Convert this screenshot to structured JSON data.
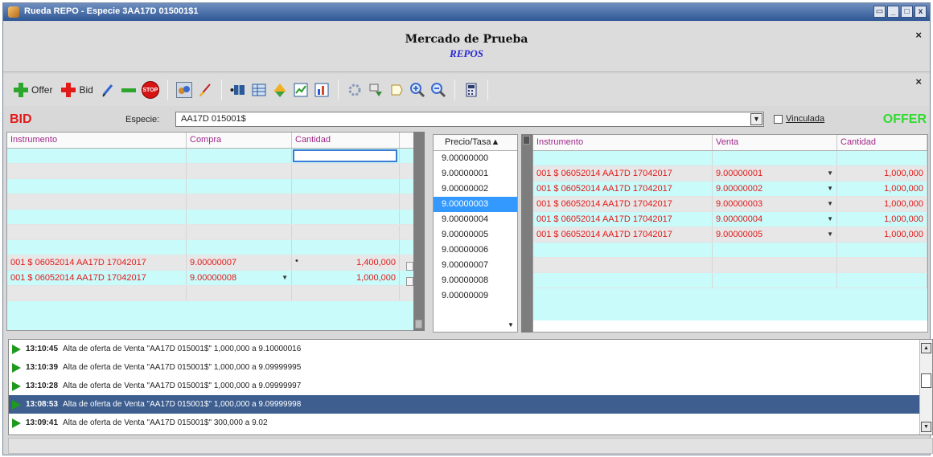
{
  "window": {
    "title": "Rueda REPO - Especie 3AA17D 015001$1"
  },
  "header": {
    "market": "Mercado de Prueba",
    "subtitle": "REPOS"
  },
  "toolbar": {
    "offer_label": "Offer",
    "bid_label": "Bid"
  },
  "bid_label": "BID",
  "offer_label": "OFFER",
  "especie": {
    "label": "Especie:",
    "value": "AA17D 015001$"
  },
  "vinculada_label": "Vinculada",
  "bid_table": {
    "headers": [
      "Instrumento",
      "Compra",
      "Cantidad"
    ],
    "rows": [
      {
        "instrumento": "001 $ 06052014 AA17D 17042017",
        "compra": "9.00000007",
        "cantidad": "1,400,000"
      },
      {
        "instrumento": "001 $ 06052014 AA17D 17042017",
        "compra": "9.00000008",
        "cantidad": "1,000,000"
      }
    ]
  },
  "prices": {
    "header": "Precio/Tasa",
    "values": [
      "9.00000000",
      "9.00000001",
      "9.00000002",
      "9.00000003",
      "9.00000004",
      "9.00000005",
      "9.00000006",
      "9.00000007",
      "9.00000008",
      "9.00000009"
    ]
  },
  "offer_table": {
    "headers": [
      "Instrumento",
      "Venta",
      "Cantidad"
    ],
    "rows": [
      {
        "instrumento": "001 $ 06052014 AA17D 17042017",
        "venta": "9.00000001",
        "cantidad": "1,000,000"
      },
      {
        "instrumento": "001 $ 06052014 AA17D 17042017",
        "venta": "9.00000002",
        "cantidad": "1,000,000"
      },
      {
        "instrumento": "001 $ 06052014 AA17D 17042017",
        "venta": "9.00000003",
        "cantidad": "1,000,000"
      },
      {
        "instrumento": "001 $ 06052014 AA17D 17042017",
        "venta": "9.00000004",
        "cantidad": "1,000,000"
      },
      {
        "instrumento": "001 $ 06052014 AA17D 17042017",
        "venta": "9.00000005",
        "cantidad": "1,000,000"
      }
    ]
  },
  "log": [
    {
      "time": "13:10:45",
      "text": "Alta de oferta de Venta \"AA17D 015001$\" 1,000,000 a 9.10000016"
    },
    {
      "time": "13:10:39",
      "text": "Alta de oferta de Venta \"AA17D 015001$\" 1,000,000 a 9.09999995"
    },
    {
      "time": "13:10:28",
      "text": "Alta de oferta de Venta \"AA17D 015001$\" 1,000,000 a 9.09999997"
    },
    {
      "time": "13:08:53",
      "text": "Alta de oferta de Venta \"AA17D 015001$\" 1,000,000 a 9.09999998"
    },
    {
      "time": "13:09:41",
      "text": "Alta de oferta de Venta \"AA17D 015001$\" 300,000 a 9.02"
    }
  ],
  "colors": {
    "bid": "#e21a1a",
    "offer": "#2fdc2f",
    "row_cyan": "#c9fbfb",
    "row_gray": "#e7e7e7",
    "selection": "#3399ff",
    "log_selection": "#3d5e8f"
  }
}
